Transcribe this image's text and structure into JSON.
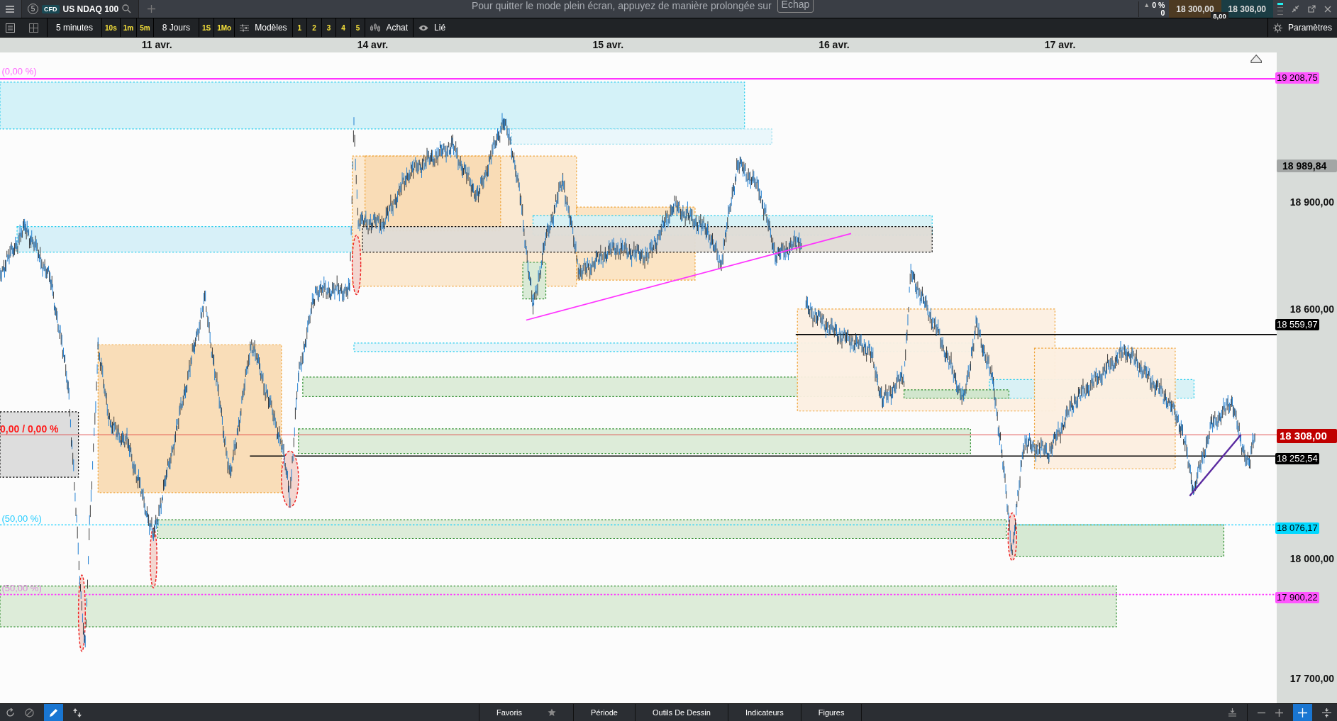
{
  "top_bar": {
    "symbol_number": "5",
    "asset_type": "CFD",
    "symbol": "US NDAQ 100",
    "fullscreen_message": "Pour quitter le mode plein écran, appuyez de manière prolongée sur",
    "escape_key": "Echap",
    "change_arrow": "▲",
    "change_percent": "0 %",
    "change_value": "0",
    "bid": "18 300,00",
    "ask": "18 308,00",
    "spread": "8,00"
  },
  "toolbar": {
    "interval": "5 minutes",
    "quick_intervals": [
      "10s",
      "1m",
      "5m"
    ],
    "range": "8 Jours",
    "quick_ranges": [
      "1S",
      "1Mo"
    ],
    "templates": "Modèles",
    "template_slots": [
      "1",
      "2",
      "3",
      "4",
      "5"
    ],
    "trade_mode": "Achat",
    "linked": "Lié",
    "settings": "Paramètres"
  },
  "date_axis": [
    "11 avr.",
    "14 avr.",
    "15 avr.",
    "16 avr.",
    "17 avr."
  ],
  "chart_labels": [
    {
      "text": "(0,00 %)",
      "color": "#ff66ff"
    },
    {
      "text": "0,00 / 0,00 %",
      "color": "#ff1a1a"
    },
    {
      "text": "(50,00 %)",
      "color": "#22ccff"
    },
    {
      "text": "(50,00 %)",
      "color": "#dd88dd"
    }
  ],
  "price_axis": {
    "ticks": [
      "18 900,00",
      "18 600,00",
      "18 000,00",
      "17 700,00"
    ],
    "markers": [
      {
        "text": "19 208,75",
        "color": "#ff55ff"
      },
      {
        "text": "18 989,84",
        "color": "#a3a6a5"
      },
      {
        "text": "18 559,97",
        "color": "#000000"
      },
      {
        "text": "18 308,00",
        "color": "#c00000"
      },
      {
        "text": "18 252,54",
        "color": "#000000"
      },
      {
        "text": "18 076,17",
        "color": "#00d8ff"
      },
      {
        "text": "17 900,22",
        "color": "#ff55ff"
      }
    ]
  },
  "bottom_bar": {
    "tabs": [
      "Favoris",
      "Période",
      "Outils De Dessin",
      "Indicateurs",
      "Figures"
    ],
    "drawing_tool_active": true
  }
}
